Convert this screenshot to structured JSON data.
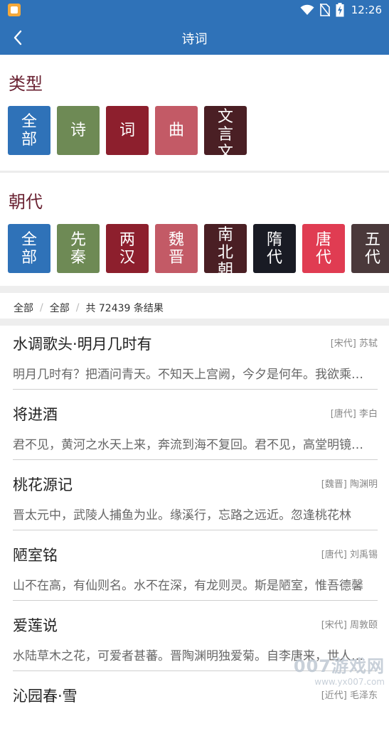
{
  "status_bar": {
    "time": "12:26",
    "icons": [
      "app-notification-icon",
      "wifi-icon",
      "no-sim-icon",
      "battery-charging-icon"
    ]
  },
  "app_bar": {
    "title": "诗词",
    "back_icon": "chevron-left-icon"
  },
  "type_section": {
    "title": "类型",
    "tiles": [
      {
        "label": "全部",
        "color": "#2f72b8"
      },
      {
        "label": "诗",
        "color": "#6e8a55"
      },
      {
        "label": "词",
        "color": "#8d1f2d"
      },
      {
        "label": "曲",
        "color": "#c35a66"
      },
      {
        "label": "文言文",
        "color": "#4a1f24"
      }
    ]
  },
  "dynasty_section": {
    "title": "朝代",
    "tiles": [
      {
        "label": "全部",
        "color": "#2f72b8"
      },
      {
        "label": "先秦",
        "color": "#6e8a55"
      },
      {
        "label": "两汉",
        "color": "#8d1f2d"
      },
      {
        "label": "魏晋",
        "color": "#c35a66"
      },
      {
        "label": "南北朝",
        "color": "#4a1f24"
      },
      {
        "label": "隋代",
        "color": "#191b24"
      },
      {
        "label": "唐代",
        "color": "#e03c52"
      },
      {
        "label": "五代",
        "color": "#4a393b"
      }
    ]
  },
  "breadcrumb": {
    "type": "全部",
    "dynasty": "全部",
    "separator": "/",
    "result_count": "共 72439 条结果"
  },
  "results": [
    {
      "title": "水调歌头·明月几时有",
      "meta": "[宋代] 苏轼",
      "excerpt": "明月几时有？把酒问青天。不知天上宫阙，今夕是何年。我欲乘风归去"
    },
    {
      "title": "将进酒",
      "meta": "[唐代] 李白",
      "excerpt": "君不见，黄河之水天上来，奔流到海不复回。君不见，高堂明镜悲白发"
    },
    {
      "title": "桃花源记",
      "meta": "[魏晋] 陶渊明",
      "excerpt": "晋太元中，武陵人捕鱼为业。缘溪行，忘路之远近。忽逢桃花林"
    },
    {
      "title": "陋室铭",
      "meta": "[唐代] 刘禹锡",
      "excerpt": "山不在高，有仙则名。水不在深，有龙则灵。斯是陋室，惟吾德馨"
    },
    {
      "title": "爱莲说",
      "meta": "[宋代] 周敦颐",
      "excerpt": "水陆草木之花，可爱者甚蕃。晋陶渊明独爱菊。自李唐来，世人甚爱牡丹"
    },
    {
      "title": "沁园春·雪",
      "meta": "[近代] 毛泽东",
      "excerpt": ""
    }
  ],
  "watermark": {
    "text": "007游戏网",
    "url": "www.yx007.com"
  }
}
